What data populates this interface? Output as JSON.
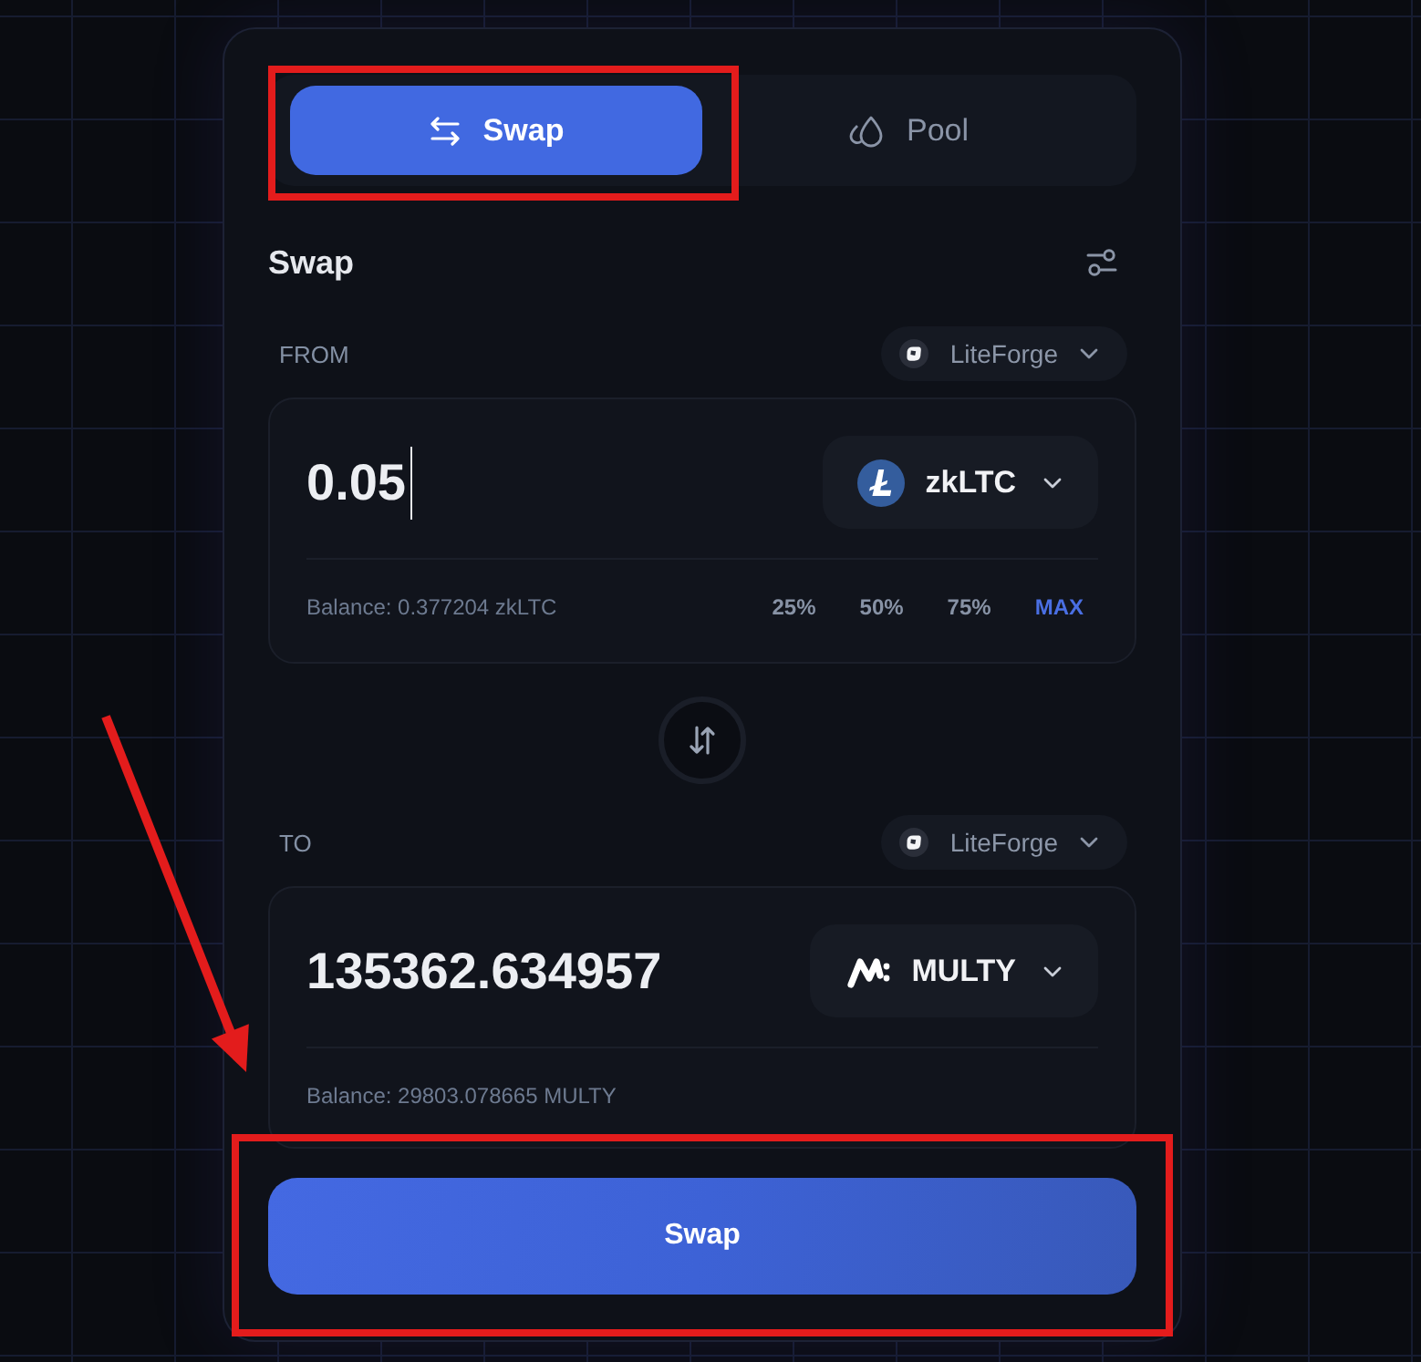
{
  "tabs": [
    {
      "label": "Swap",
      "kind": "swap",
      "selected": true,
      "highlighted": true
    },
    {
      "label": "Pool",
      "kind": "pool",
      "selected": false,
      "highlighted": false
    }
  ],
  "header": {
    "title": "Swap"
  },
  "from": {
    "label": "FROM",
    "network": "LiteForge",
    "amount": "0.05",
    "focused": true,
    "token": {
      "symbol": "zkLTC",
      "kind": "coin"
    },
    "balance": "Balance: 0.377204 zkLTC",
    "presets": [
      {
        "label": "25%",
        "kind": "percent"
      },
      {
        "label": "50%",
        "kind": "percent"
      },
      {
        "label": "75%",
        "kind": "percent"
      },
      {
        "label": "MAX",
        "kind": "max"
      }
    ]
  },
  "to": {
    "label": "TO",
    "network": "LiteForge",
    "amount": "135362.634957",
    "focused": false,
    "token": {
      "symbol": "MULTY",
      "kind": "zigzag"
    },
    "balance": "Balance: 29803.078665 MULTY"
  },
  "swap_button": {
    "label": "Swap",
    "highlighted": true,
    "arrow": true
  }
}
